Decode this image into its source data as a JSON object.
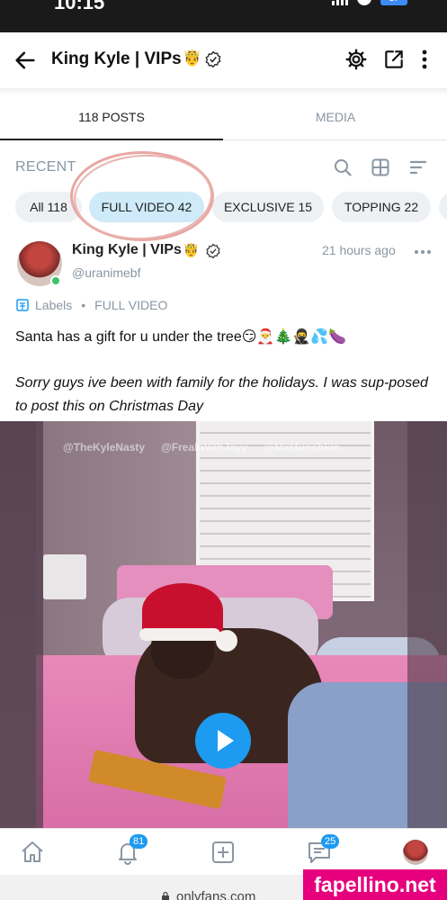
{
  "status_bar": {
    "time": "10:15",
    "battery": "17"
  },
  "header": {
    "title": "King Kyle | VIPs",
    "title_emoji": "🤴"
  },
  "tabs": [
    {
      "label": "118 POSTS",
      "active": true
    },
    {
      "label": "MEDIA",
      "active": false
    }
  ],
  "filter": {
    "section_label": "RECENT"
  },
  "chips": [
    {
      "label": "All 118",
      "active": false
    },
    {
      "label": "FULL VIDEO 42",
      "active": true
    },
    {
      "label": "EXCLUSIVE 15",
      "active": false
    },
    {
      "label": "TOPPING 22",
      "active": false
    }
  ],
  "post": {
    "author_name": "King Kyle | VIPs",
    "author_emoji": "🤴",
    "handle": "@uranimebf",
    "time": "21 hours ago",
    "labels_text": "Labels",
    "label_value": "FULL VIDEO",
    "text_line1": "Santa has a gift for u under the tree😏🎅🎄🥷💦🍆",
    "text_line2": "Sorry guys ive been with family for the holidays. I was sup-posed to post this on Christmas Day",
    "media_watermarks": [
      "@TheKyleNasty",
      "@FreakWithJayy",
      "@MxMunchkin"
    ]
  },
  "bottom_nav": {
    "notifications_badge": "81",
    "messages_badge": "25"
  },
  "browser": {
    "url": "onlyfans.com"
  },
  "site_watermark": "fapellino.net",
  "colors": {
    "accent": "#1d9bf0",
    "chip_active": "#cfeaf8",
    "muted": "#8a96a3",
    "watermark_bg": "#e6007e"
  }
}
